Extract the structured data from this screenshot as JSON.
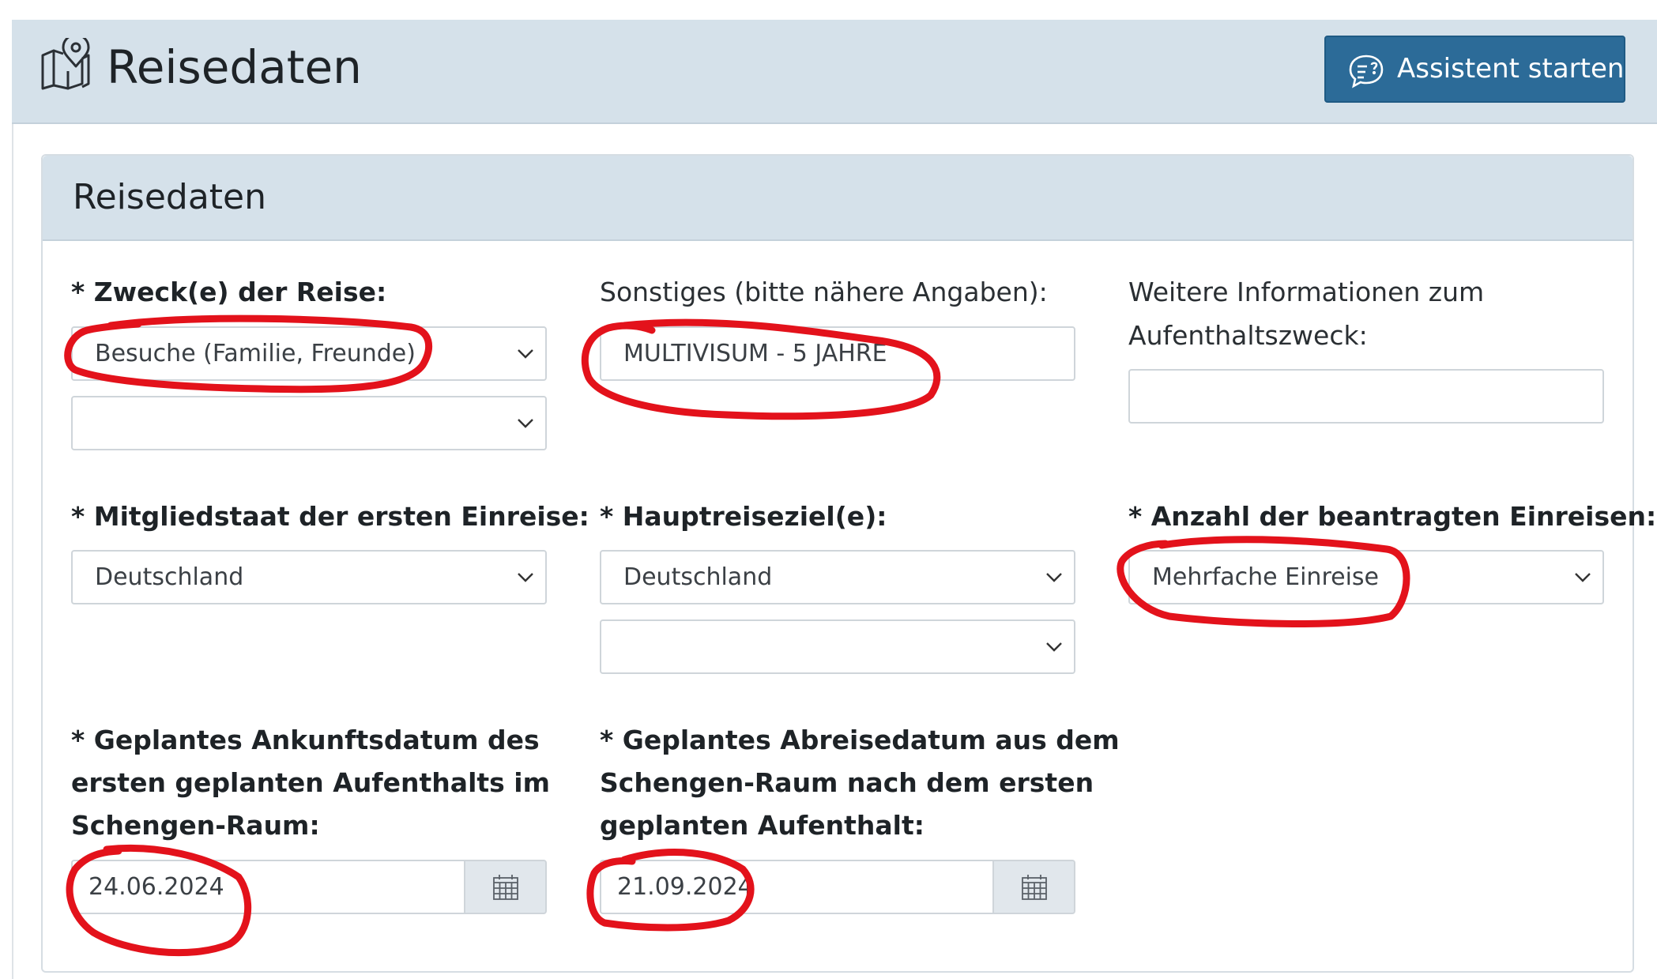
{
  "header": {
    "title": "Reisedaten",
    "assistant_button": "Assistent starten",
    "icons": {
      "page_icon": "map-location-icon",
      "button_icon": "chat-question-icon"
    }
  },
  "card": {
    "title": "Reisedaten",
    "fields": {
      "purpose": {
        "label": "* Zweck(e) der Reise:",
        "value": "Besuche (Familie, Freunde)",
        "second_value": ""
      },
      "other": {
        "label": "Sonstiges (bitte nähere Angaben):",
        "value": "MULTIVISUM - 5 JAHRE"
      },
      "more_info": {
        "label_line1": "Weitere Informationen zum",
        "label_line2": "Aufenthaltszweck:",
        "value": ""
      },
      "member_state": {
        "label": "* Mitgliedstaat der ersten Einreise:",
        "value": "Deutschland"
      },
      "main_destination": {
        "label": "* Hauptreiseziel(e):",
        "value": "Deutschland",
        "second_value": ""
      },
      "entries": {
        "label": "* Anzahl der beantragten Einreisen:",
        "value": "Mehrfache Einreise"
      },
      "arrival": {
        "label_line1": "* Geplantes Ankunftsdatum des",
        "label_line2": "ersten geplanten Aufenthalts im",
        "label_line3": "Schengen-Raum:",
        "value": "24.06.2024"
      },
      "departure": {
        "label_line1": "* Geplantes Abreisedatum aus dem",
        "label_line2": "Schengen-Raum nach dem ersten",
        "label_line3": "geplanten Aufenthalt:",
        "value": "21.09.2024"
      }
    }
  },
  "colors": {
    "header_bg": "#d5e1ea",
    "button_bg": "#2c6b98",
    "annotation": "#e3121b"
  }
}
